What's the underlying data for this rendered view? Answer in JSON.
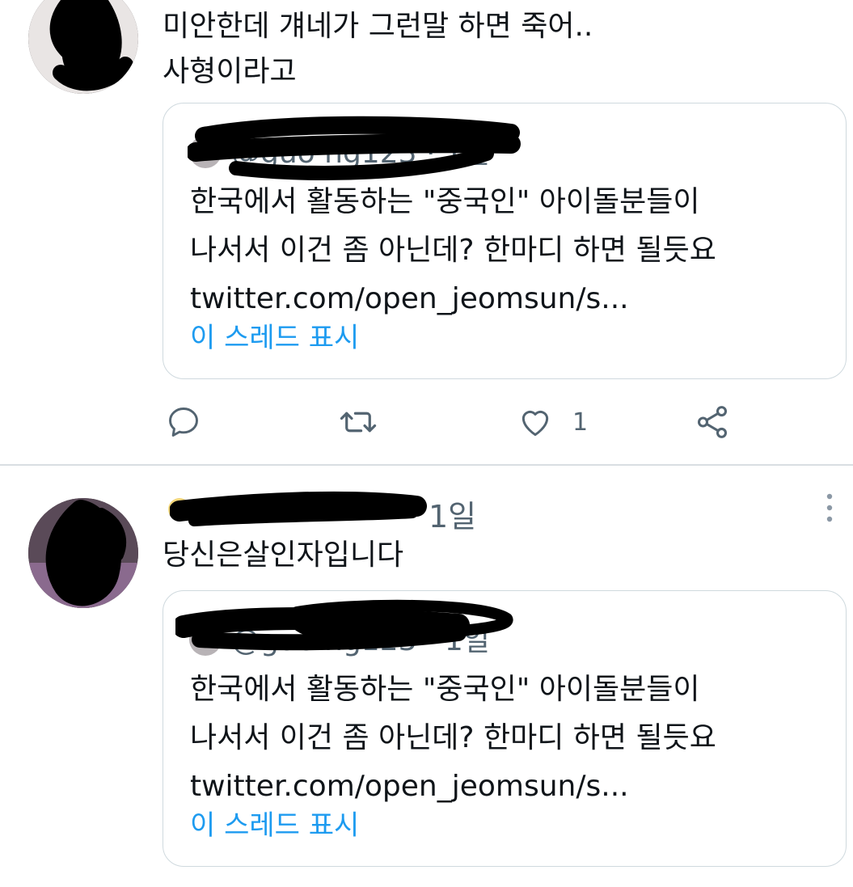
{
  "tweet1": {
    "text_line1": "미안한데 걔네가 그런말 하면 죽어..",
    "text_line2": "사형이라고",
    "quote": {
      "meta": "@guo     ng123 · 1일",
      "lines": [
        "한국에서 활동하는 \"중국인\" 아이돌분들이",
        "나서서 이건 좀 아닌데? 한마디 하면 될듯요",
        "twitter.com/open_jeomsun/s..."
      ],
      "thread_link": "이 스레드 표시"
    },
    "actions": {
      "reply": "reply-icon",
      "retweet": "retweet-icon",
      "like": "heart-icon",
      "like_count": "1",
      "share": "share-icon"
    }
  },
  "tweet2": {
    "meta_time": "1일",
    "text": "당신은살인자입니다",
    "quote": {
      "meta": "@guo     ng123 · 1일",
      "lines": [
        "한국에서 활동하는 \"중국인\" 아이돌분들이",
        "나서서 이건 좀 아닌데? 한마디 하면 될듯요",
        "twitter.com/open_jeomsun/s..."
      ],
      "thread_link": "이 스레드 표시"
    }
  },
  "colors": {
    "text": "#0f1419",
    "muted": "#536471",
    "link": "#1d9bf0",
    "border": "#cfd9de",
    "redaction": "#000000"
  }
}
